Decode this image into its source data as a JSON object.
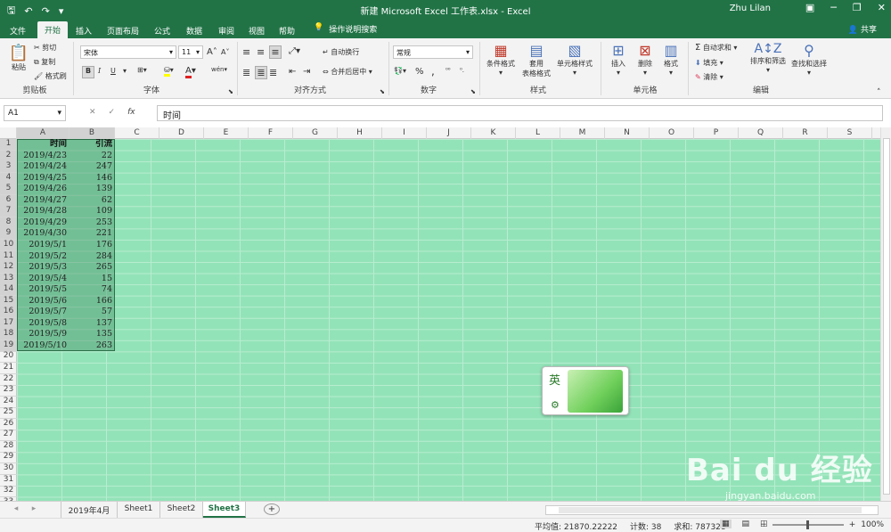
{
  "titlebar": {
    "doc_title": "新建 Microsoft Excel 工作表.xlsx  -  Excel",
    "user": "Zhu Lilan",
    "qat": [
      "save-icon",
      "undo-icon",
      "redo-icon",
      "customize-icon"
    ],
    "window_buttons": [
      "ribbon-display-icon",
      "minimize-icon",
      "restore-icon",
      "close-icon"
    ]
  },
  "tabs": [
    {
      "label": "文件",
      "active": false
    },
    {
      "label": "开始",
      "active": true
    },
    {
      "label": "插入",
      "active": false
    },
    {
      "label": "页面布局",
      "active": false
    },
    {
      "label": "公式",
      "active": false
    },
    {
      "label": "数据",
      "active": false
    },
    {
      "label": "审阅",
      "active": false
    },
    {
      "label": "视图",
      "active": false
    },
    {
      "label": "帮助",
      "active": false
    }
  ],
  "tell_me": "操作说明搜索",
  "share": "共享",
  "ribbon": {
    "clipboard": {
      "paste": "粘贴",
      "cut": "剪切",
      "copy": "复制",
      "format_painter": "格式刷",
      "label": "剪贴板"
    },
    "font": {
      "name": "宋体",
      "size": "11",
      "bold": "B",
      "italic": "I",
      "underline": "U",
      "label": "字体",
      "grow": "A",
      "shrink": "A",
      "wen": "wén"
    },
    "alignment": {
      "wrap": "自动换行",
      "merge": "合并后居中",
      "label": "对齐方式"
    },
    "number": {
      "format": "常规",
      "percent": "%",
      "comma": ",",
      "label": "数字"
    },
    "styles": {
      "conditional": "条件格式",
      "table_line1": "套用",
      "table_line2": "表格格式",
      "cell_styles": "单元格样式",
      "label": "样式"
    },
    "cells": {
      "insert": "插入",
      "delete": "删除",
      "format": "格式",
      "label": "单元格"
    },
    "editing": {
      "autosum": "自动求和",
      "fill": "填充",
      "clear": "清除",
      "sort": "排序和筛选",
      "find": "查找和选择",
      "label": "编辑"
    }
  },
  "formula_bar": {
    "name_box": "A1",
    "cancel": "✕",
    "enter": "✓",
    "fx": "fx",
    "content": "时间"
  },
  "columns": [
    "A",
    "B",
    "C",
    "D",
    "E",
    "F",
    "G",
    "H",
    "I",
    "J",
    "K",
    "L",
    "M",
    "N",
    "O",
    "P",
    "Q",
    "R",
    "S"
  ],
  "rows": [
    "1",
    "2",
    "3",
    "4",
    "5",
    "6",
    "7",
    "8",
    "9",
    "10",
    "11",
    "12",
    "13",
    "14",
    "15",
    "16",
    "17",
    "18",
    "19",
    "20",
    "21",
    "22",
    "23",
    "24",
    "25",
    "26",
    "27",
    "28",
    "29",
    "30",
    "31",
    "32",
    "33"
  ],
  "sheet": {
    "header": {
      "a": "时间",
      "b": "引流"
    },
    "data": [
      {
        "a": "2019/4/23",
        "b": "22"
      },
      {
        "a": "2019/4/24",
        "b": "247"
      },
      {
        "a": "2019/4/25",
        "b": "146"
      },
      {
        "a": "2019/4/26",
        "b": "139"
      },
      {
        "a": "2019/4/27",
        "b": "62"
      },
      {
        "a": "2019/4/28",
        "b": "109"
      },
      {
        "a": "2019/4/29",
        "b": "253"
      },
      {
        "a": "2019/4/30",
        "b": "221"
      },
      {
        "a": "2019/5/1",
        "b": "176"
      },
      {
        "a": "2019/5/2",
        "b": "284"
      },
      {
        "a": "2019/5/3",
        "b": "265"
      },
      {
        "a": "2019/5/4",
        "b": "15"
      },
      {
        "a": "2019/5/5",
        "b": "74"
      },
      {
        "a": "2019/5/6",
        "b": "166"
      },
      {
        "a": "2019/5/7",
        "b": "57"
      },
      {
        "a": "2019/5/8",
        "b": "137"
      },
      {
        "a": "2019/5/9",
        "b": "135"
      },
      {
        "a": "2019/5/10",
        "b": "263"
      }
    ]
  },
  "ime": {
    "label": "英"
  },
  "sheet_tabs": [
    {
      "label": "2019年4月",
      "active": false
    },
    {
      "label": "Sheet1",
      "active": false
    },
    {
      "label": "Sheet2",
      "active": false
    },
    {
      "label": "Sheet3",
      "active": true
    }
  ],
  "add_sheet": "+",
  "status": {
    "average": "平均值: 21870.22222",
    "count": "计数: 38",
    "sum": "求和: 787328",
    "zoom": "100%"
  },
  "watermark": {
    "line1": "Bai du 经验",
    "line2": "jingyan.baidu.com"
  }
}
